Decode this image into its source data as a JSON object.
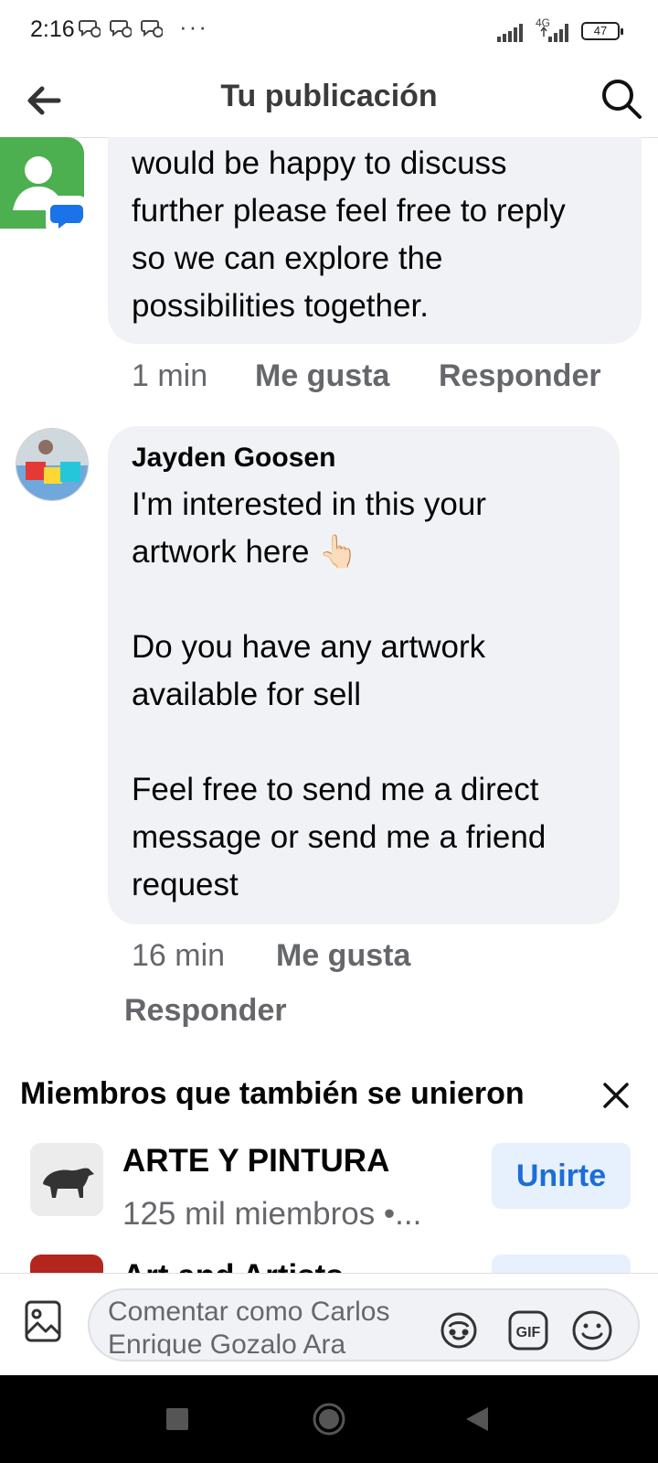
{
  "status_bar": {
    "time": "2:16",
    "overflow": "···",
    "network": "4G",
    "battery": "47"
  },
  "app_bar": {
    "title": "Tu publicación",
    "back_icon": "arrow-left-icon",
    "search_icon": "search-icon"
  },
  "comments": [
    {
      "text": "would be happy to discuss\nfurther please feel free to reply\nso we can explore the\npossibilities together.",
      "time": "1 min",
      "like_label": "Me gusta",
      "reply_label": "Responder"
    },
    {
      "author": "Jayden Goosen",
      "text": "I'm interested in this your\nartwork here 👆🏻\n\nDo you have any artwork\navailable for sell\n\nFeel free to send me a direct\nmessage or send me a friend\nrequest",
      "time": "16 min",
      "like_label": "Me gusta",
      "reply_label": "Responder"
    }
  ],
  "suggested": {
    "title": "Miembros que también se unieron",
    "groups": [
      {
        "name": "ARTE Y PINTURA",
        "subtitle": "125 mil miembros •...",
        "join_label": "Unirte"
      },
      {
        "name": "Art and Artists"
      }
    ]
  },
  "composer": {
    "placeholder": "Comentar como Carlos Enrique Gozalo Ara",
    "icons": [
      "photo-icon",
      "avatar-sticker-icon",
      "gif-icon",
      "emoji-icon"
    ]
  },
  "colors": {
    "bubble": "#f0f2f5",
    "secondary_text": "#65676b",
    "join_bg": "#e7f0fd",
    "join_text": "#1b6ed6"
  }
}
